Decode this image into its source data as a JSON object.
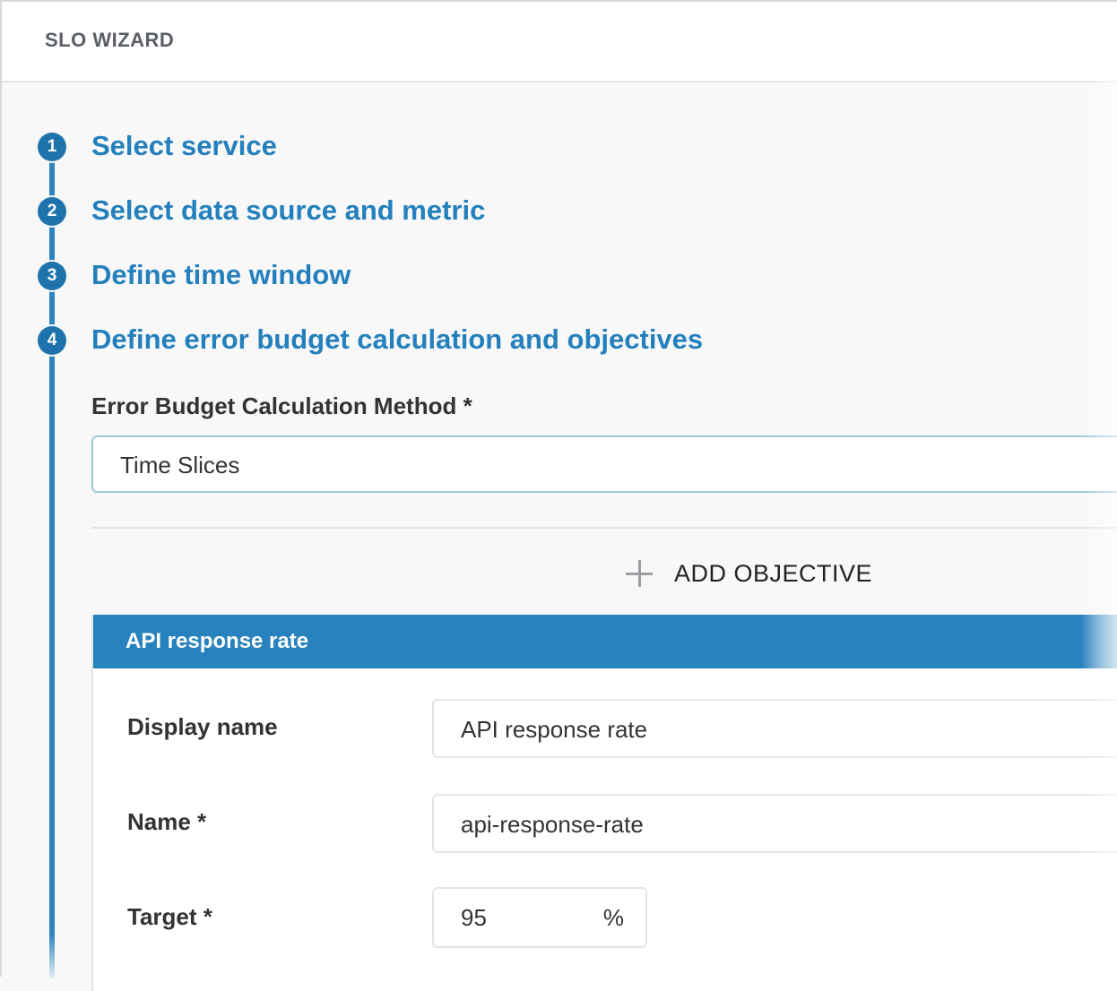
{
  "header": {
    "title": "SLO WIZARD"
  },
  "steps": [
    {
      "number": "1",
      "label": "Select service"
    },
    {
      "number": "2",
      "label": "Select data source and metric"
    },
    {
      "number": "3",
      "label": "Define time window"
    },
    {
      "number": "4",
      "label": "Define error budget calculation and objectives"
    }
  ],
  "error_budget": {
    "label": "Error Budget Calculation Method *",
    "selected_value": "Time Slices"
  },
  "add_objective": {
    "label": "ADD OBJECTIVE",
    "icon": "plus-icon"
  },
  "objective": {
    "title": "API response rate",
    "display_name": {
      "label": "Display name",
      "value": "API response rate"
    },
    "name": {
      "label": "Name *",
      "value": "api-response-rate"
    },
    "target": {
      "label": "Target *",
      "value": "95",
      "unit": "%"
    }
  },
  "colors": {
    "accent": "#2480bd",
    "step_circle": "#1f73ad",
    "objective_header": "#2882bd"
  }
}
